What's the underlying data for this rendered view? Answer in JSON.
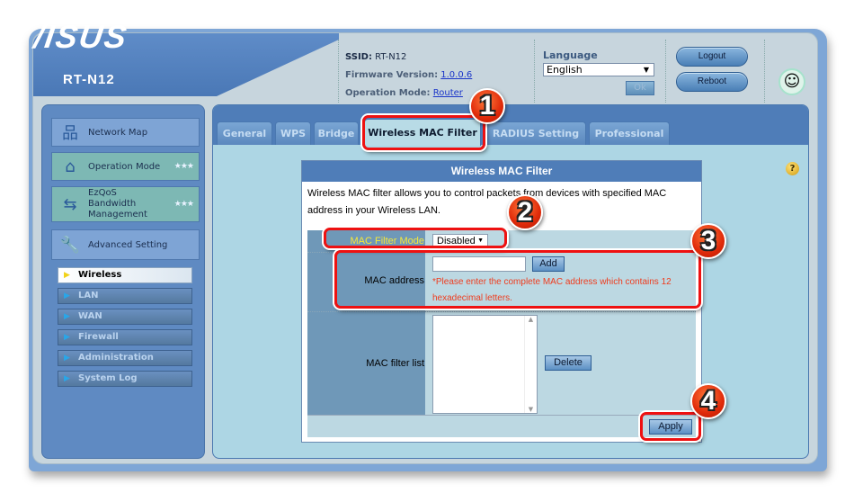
{
  "header": {
    "logo": "/ISUS",
    "model": "RT-N12",
    "ssid_label": "SSID:",
    "ssid_value": "RT-N12",
    "firmware_label": "Firmware Version:",
    "firmware_value": "1.0.0.6",
    "mode_label": "Operation Mode:",
    "mode_value": "Router",
    "language_label": "Language",
    "language_value": "English",
    "ok_label": "Ok",
    "logout_label": "Logout",
    "reboot_label": "Reboot"
  },
  "sidebar": {
    "main_items": [
      {
        "label": "Network Map",
        "icon": "network-map-icon"
      },
      {
        "label": "Operation Mode",
        "icon": "router-icon"
      },
      {
        "label": "EzQoS Bandwidth Management",
        "icon": "bandwidth-icon"
      },
      {
        "label": "Advanced Setting",
        "icon": "tools-icon"
      }
    ],
    "sub_items": [
      {
        "label": "Wireless",
        "active": true
      },
      {
        "label": "LAN",
        "active": false
      },
      {
        "label": "WAN",
        "active": false
      },
      {
        "label": "Firewall",
        "active": false
      },
      {
        "label": "Administration",
        "active": false
      },
      {
        "label": "System Log",
        "active": false
      }
    ]
  },
  "tabs": [
    {
      "label": "General"
    },
    {
      "label": "WPS"
    },
    {
      "label": "Bridge"
    },
    {
      "label": "Wireless MAC Filter",
      "active": true
    },
    {
      "label": "RADIUS Setting"
    },
    {
      "label": "Professional"
    }
  ],
  "panel": {
    "title": "Wireless MAC Filter",
    "description": "Wireless MAC filter allows you to control packets from devices with specified MAC address in your Wireless LAN.",
    "filter_mode_label": "MAC Filter Mode",
    "filter_mode_value": "Disabled",
    "mac_address_label": "MAC address",
    "mac_address_value": "",
    "add_label": "Add",
    "hint": "*Please enter the complete MAC address which contains 12 hexadecimal letters.",
    "filter_list_label": "MAC filter list",
    "delete_label": "Delete",
    "apply_label": "Apply"
  },
  "annotations": [
    "1",
    "2",
    "3",
    "4"
  ],
  "colors": {
    "highlight": "#ee1111",
    "hint": "#ef3c1e",
    "header_blue": "#4f7db8"
  }
}
